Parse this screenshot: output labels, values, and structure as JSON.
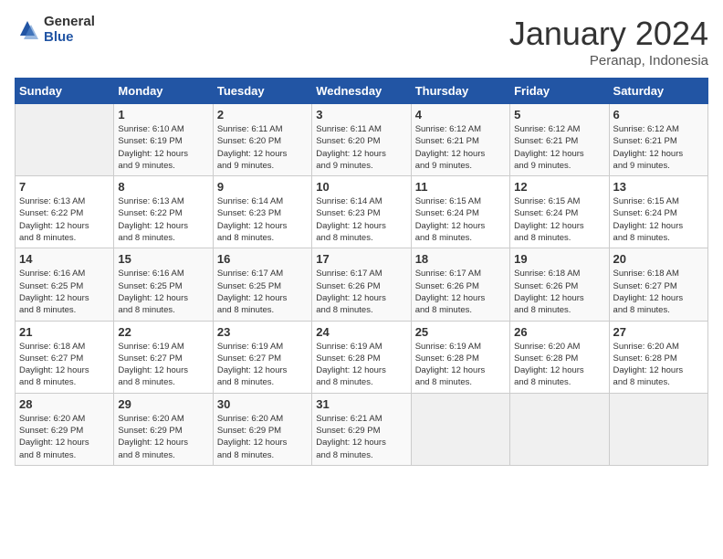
{
  "header": {
    "logo_general": "General",
    "logo_blue": "Blue",
    "month_title": "January 2024",
    "subtitle": "Peranap, Indonesia"
  },
  "days_of_week": [
    "Sunday",
    "Monday",
    "Tuesday",
    "Wednesday",
    "Thursday",
    "Friday",
    "Saturday"
  ],
  "weeks": [
    [
      {
        "day": "",
        "info": ""
      },
      {
        "day": "1",
        "info": "Sunrise: 6:10 AM\nSunset: 6:19 PM\nDaylight: 12 hours\nand 9 minutes."
      },
      {
        "day": "2",
        "info": "Sunrise: 6:11 AM\nSunset: 6:20 PM\nDaylight: 12 hours\nand 9 minutes."
      },
      {
        "day": "3",
        "info": "Sunrise: 6:11 AM\nSunset: 6:20 PM\nDaylight: 12 hours\nand 9 minutes."
      },
      {
        "day": "4",
        "info": "Sunrise: 6:12 AM\nSunset: 6:21 PM\nDaylight: 12 hours\nand 9 minutes."
      },
      {
        "day": "5",
        "info": "Sunrise: 6:12 AM\nSunset: 6:21 PM\nDaylight: 12 hours\nand 9 minutes."
      },
      {
        "day": "6",
        "info": "Sunrise: 6:12 AM\nSunset: 6:21 PM\nDaylight: 12 hours\nand 9 minutes."
      }
    ],
    [
      {
        "day": "7",
        "info": "Sunrise: 6:13 AM\nSunset: 6:22 PM\nDaylight: 12 hours\nand 8 minutes."
      },
      {
        "day": "8",
        "info": "Sunrise: 6:13 AM\nSunset: 6:22 PM\nDaylight: 12 hours\nand 8 minutes."
      },
      {
        "day": "9",
        "info": "Sunrise: 6:14 AM\nSunset: 6:23 PM\nDaylight: 12 hours\nand 8 minutes."
      },
      {
        "day": "10",
        "info": "Sunrise: 6:14 AM\nSunset: 6:23 PM\nDaylight: 12 hours\nand 8 minutes."
      },
      {
        "day": "11",
        "info": "Sunrise: 6:15 AM\nSunset: 6:24 PM\nDaylight: 12 hours\nand 8 minutes."
      },
      {
        "day": "12",
        "info": "Sunrise: 6:15 AM\nSunset: 6:24 PM\nDaylight: 12 hours\nand 8 minutes."
      },
      {
        "day": "13",
        "info": "Sunrise: 6:15 AM\nSunset: 6:24 PM\nDaylight: 12 hours\nand 8 minutes."
      }
    ],
    [
      {
        "day": "14",
        "info": "Sunrise: 6:16 AM\nSunset: 6:25 PM\nDaylight: 12 hours\nand 8 minutes."
      },
      {
        "day": "15",
        "info": "Sunrise: 6:16 AM\nSunset: 6:25 PM\nDaylight: 12 hours\nand 8 minutes."
      },
      {
        "day": "16",
        "info": "Sunrise: 6:17 AM\nSunset: 6:25 PM\nDaylight: 12 hours\nand 8 minutes."
      },
      {
        "day": "17",
        "info": "Sunrise: 6:17 AM\nSunset: 6:26 PM\nDaylight: 12 hours\nand 8 minutes."
      },
      {
        "day": "18",
        "info": "Sunrise: 6:17 AM\nSunset: 6:26 PM\nDaylight: 12 hours\nand 8 minutes."
      },
      {
        "day": "19",
        "info": "Sunrise: 6:18 AM\nSunset: 6:26 PM\nDaylight: 12 hours\nand 8 minutes."
      },
      {
        "day": "20",
        "info": "Sunrise: 6:18 AM\nSunset: 6:27 PM\nDaylight: 12 hours\nand 8 minutes."
      }
    ],
    [
      {
        "day": "21",
        "info": "Sunrise: 6:18 AM\nSunset: 6:27 PM\nDaylight: 12 hours\nand 8 minutes."
      },
      {
        "day": "22",
        "info": "Sunrise: 6:19 AM\nSunset: 6:27 PM\nDaylight: 12 hours\nand 8 minutes."
      },
      {
        "day": "23",
        "info": "Sunrise: 6:19 AM\nSunset: 6:27 PM\nDaylight: 12 hours\nand 8 minutes."
      },
      {
        "day": "24",
        "info": "Sunrise: 6:19 AM\nSunset: 6:28 PM\nDaylight: 12 hours\nand 8 minutes."
      },
      {
        "day": "25",
        "info": "Sunrise: 6:19 AM\nSunset: 6:28 PM\nDaylight: 12 hours\nand 8 minutes."
      },
      {
        "day": "26",
        "info": "Sunrise: 6:20 AM\nSunset: 6:28 PM\nDaylight: 12 hours\nand 8 minutes."
      },
      {
        "day": "27",
        "info": "Sunrise: 6:20 AM\nSunset: 6:28 PM\nDaylight: 12 hours\nand 8 minutes."
      }
    ],
    [
      {
        "day": "28",
        "info": "Sunrise: 6:20 AM\nSunset: 6:29 PM\nDaylight: 12 hours\nand 8 minutes."
      },
      {
        "day": "29",
        "info": "Sunrise: 6:20 AM\nSunset: 6:29 PM\nDaylight: 12 hours\nand 8 minutes."
      },
      {
        "day": "30",
        "info": "Sunrise: 6:20 AM\nSunset: 6:29 PM\nDaylight: 12 hours\nand 8 minutes."
      },
      {
        "day": "31",
        "info": "Sunrise: 6:21 AM\nSunset: 6:29 PM\nDaylight: 12 hours\nand 8 minutes."
      },
      {
        "day": "",
        "info": ""
      },
      {
        "day": "",
        "info": ""
      },
      {
        "day": "",
        "info": ""
      }
    ]
  ]
}
